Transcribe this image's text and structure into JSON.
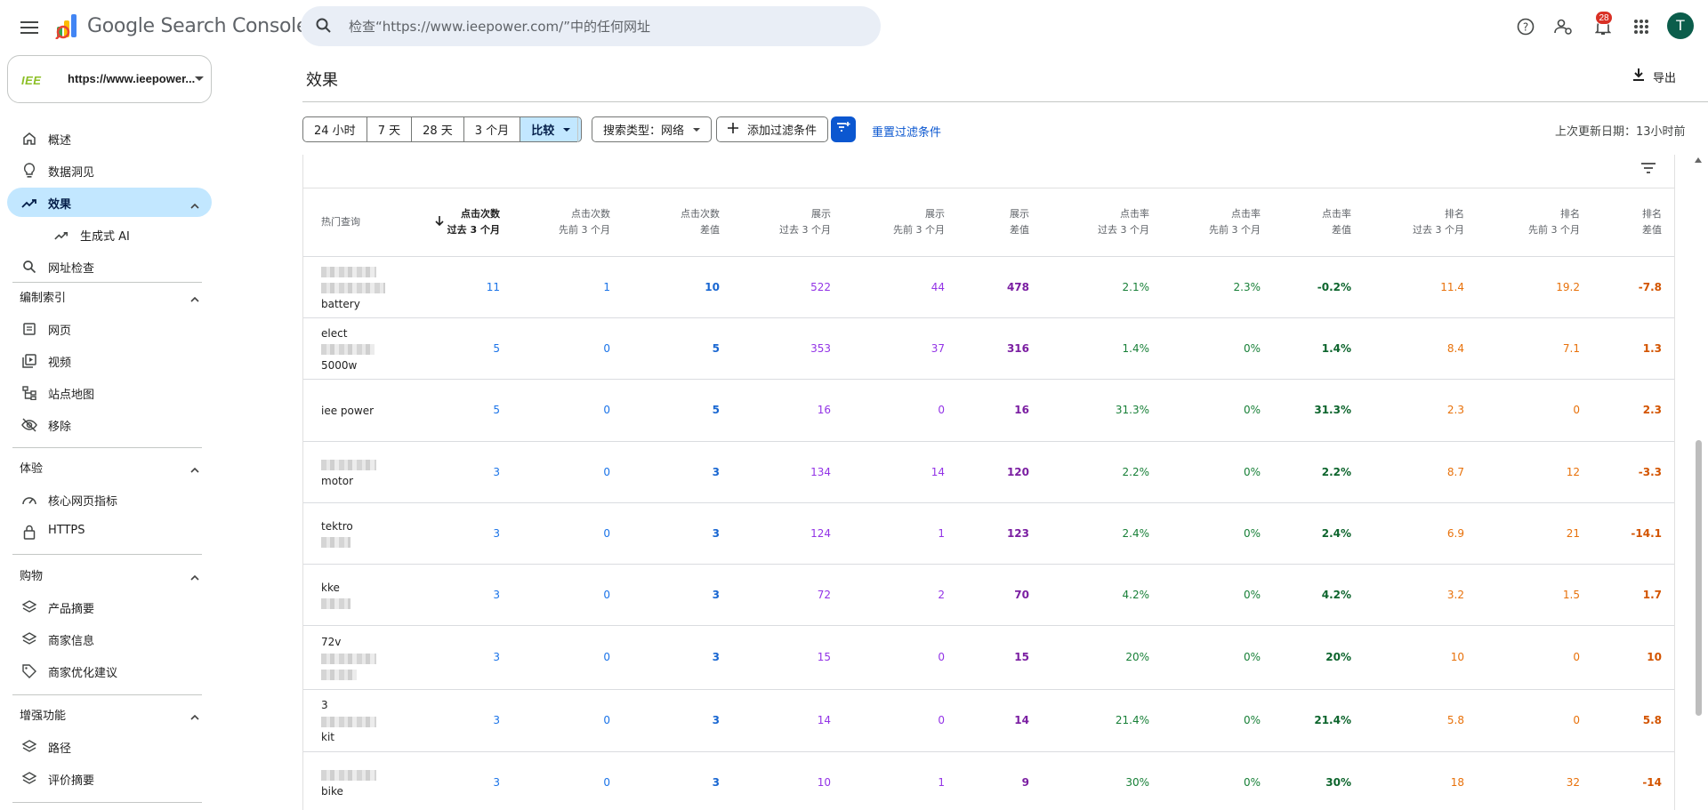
{
  "app": {
    "title": "Google Search Console"
  },
  "search": {
    "placeholder": "检查“https://www.ieepower.com/”中的任何网址"
  },
  "notifications": {
    "count": "28"
  },
  "user": {
    "avatar_letter": "T"
  },
  "property": {
    "logo": "IEE",
    "url": "https://www.ieepower..."
  },
  "sidebar": {
    "items": [
      {
        "label": "概述",
        "icon": "home-icon"
      },
      {
        "label": "数据洞见",
        "icon": "lightbulb-icon"
      },
      {
        "label": "效果",
        "icon": "trending-up-icon",
        "active": true
      },
      {
        "label": "生成式 AI",
        "icon": "trending-up-icon"
      },
      {
        "label": "网址检查",
        "icon": "search-icon"
      }
    ],
    "sections": [
      {
        "label": "编制索引",
        "items": [
          {
            "label": "网页",
            "icon": "pages-icon"
          },
          {
            "label": "视频",
            "icon": "video-icon"
          },
          {
            "label": "站点地图",
            "icon": "sitemap-icon"
          },
          {
            "label": "移除",
            "icon": "eye-off-icon"
          }
        ]
      },
      {
        "label": "体验",
        "items": [
          {
            "label": "核心网页指标",
            "icon": "speed-icon"
          },
          {
            "label": "HTTPS",
            "icon": "lock-icon"
          }
        ]
      },
      {
        "label": "购物",
        "items": [
          {
            "label": "产品摘要",
            "icon": "layers-icon"
          },
          {
            "label": "商家信息",
            "icon": "layers-icon"
          },
          {
            "label": "商家优化建议",
            "icon": "tag-icon"
          }
        ]
      },
      {
        "label": "增强功能",
        "items": [
          {
            "label": "路径",
            "icon": "layers-icon"
          },
          {
            "label": "评价摘要",
            "icon": "layers-icon"
          }
        ]
      }
    ]
  },
  "main": {
    "title": "效果",
    "export_label": "导出",
    "ranges": [
      "24 小时",
      "7 天",
      "28 天",
      "3 个月",
      "比较"
    ],
    "search_type_chip": "搜索类型：网络",
    "add_filter_chip": "添加过滤条件",
    "reset_label": "重置过滤条件",
    "updated_label": "上次更新日期：13小时前"
  },
  "table": {
    "headers": [
      {
        "l1": "热门查询",
        "l2": ""
      },
      {
        "l1": "点击次数",
        "l2": "过去 3 个月"
      },
      {
        "l1": "点击次数",
        "l2": "先前 3 个月"
      },
      {
        "l1": "点击次数",
        "l2": "差值"
      },
      {
        "l1": "展示",
        "l2": "过去 3 个月"
      },
      {
        "l1": "展示",
        "l2": "先前 3 个月"
      },
      {
        "l1": "展示",
        "l2": "差值"
      },
      {
        "l1": "点击率",
        "l2": "过去 3 个月"
      },
      {
        "l1": "点击率",
        "l2": "先前 3 个月"
      },
      {
        "l1": "点击率",
        "l2": "差值"
      },
      {
        "l1": "排名",
        "l2": "过去 3 个月"
      },
      {
        "l1": "排名",
        "l2": "先前 3 个月"
      },
      {
        "l1": "排名",
        "l2": "差值"
      }
    ],
    "rows": [
      {
        "query_parts": [
          "",
          "",
          "battery"
        ],
        "values": [
          "11",
          "1",
          "10",
          "522",
          "44",
          "478",
          "2.1%",
          "2.3%",
          "-0.2%",
          "11.4",
          "19.2",
          "-7.8"
        ]
      },
      {
        "query_parts": [
          "elect",
          "",
          "5000w"
        ],
        "values": [
          "5",
          "0",
          "5",
          "353",
          "37",
          "316",
          "1.4%",
          "0%",
          "1.4%",
          "8.4",
          "7.1",
          "1.3"
        ]
      },
      {
        "query_parts": [
          "iee power"
        ],
        "values": [
          "5",
          "0",
          "5",
          "16",
          "0",
          "16",
          "31.3%",
          "0%",
          "31.3%",
          "2.3",
          "0",
          "2.3"
        ]
      },
      {
        "query_parts": [
          "",
          "motor"
        ],
        "values": [
          "3",
          "0",
          "3",
          "134",
          "14",
          "120",
          "2.2%",
          "0%",
          "2.2%",
          "8.7",
          "12",
          "-3.3"
        ]
      },
      {
        "query_parts": [
          "tektro",
          ""
        ],
        "values": [
          "3",
          "0",
          "3",
          "124",
          "1",
          "123",
          "2.4%",
          "0%",
          "2.4%",
          "6.9",
          "21",
          "-14.1"
        ]
      },
      {
        "query_parts": [
          "kke",
          ""
        ],
        "values": [
          "3",
          "0",
          "3",
          "72",
          "2",
          "70",
          "4.2%",
          "0%",
          "4.2%",
          "3.2",
          "1.5",
          "1.7"
        ]
      },
      {
        "query_parts": [
          "72v",
          "",
          ""
        ],
        "values": [
          "3",
          "0",
          "3",
          "15",
          "0",
          "15",
          "20%",
          "0%",
          "20%",
          "10",
          "0",
          "10"
        ]
      },
      {
        "query_parts": [
          "3",
          "",
          "kit"
        ],
        "values": [
          "3",
          "0",
          "3",
          "14",
          "0",
          "14",
          "21.4%",
          "0%",
          "21.4%",
          "5.8",
          "0",
          "5.8"
        ]
      },
      {
        "query_parts": [
          "",
          "bike"
        ],
        "values": [
          "3",
          "0",
          "3",
          "10",
          "1",
          "9",
          "30%",
          "0%",
          "30%",
          "18",
          "32",
          "-14"
        ]
      }
    ]
  },
  "colors": {
    "active_nav": "#c2e7ff",
    "clicks": "#1a73e8",
    "impressions": "#9334e6",
    "ctr": "#188038",
    "position": "#e8710a",
    "primary": "#0b57d0"
  }
}
